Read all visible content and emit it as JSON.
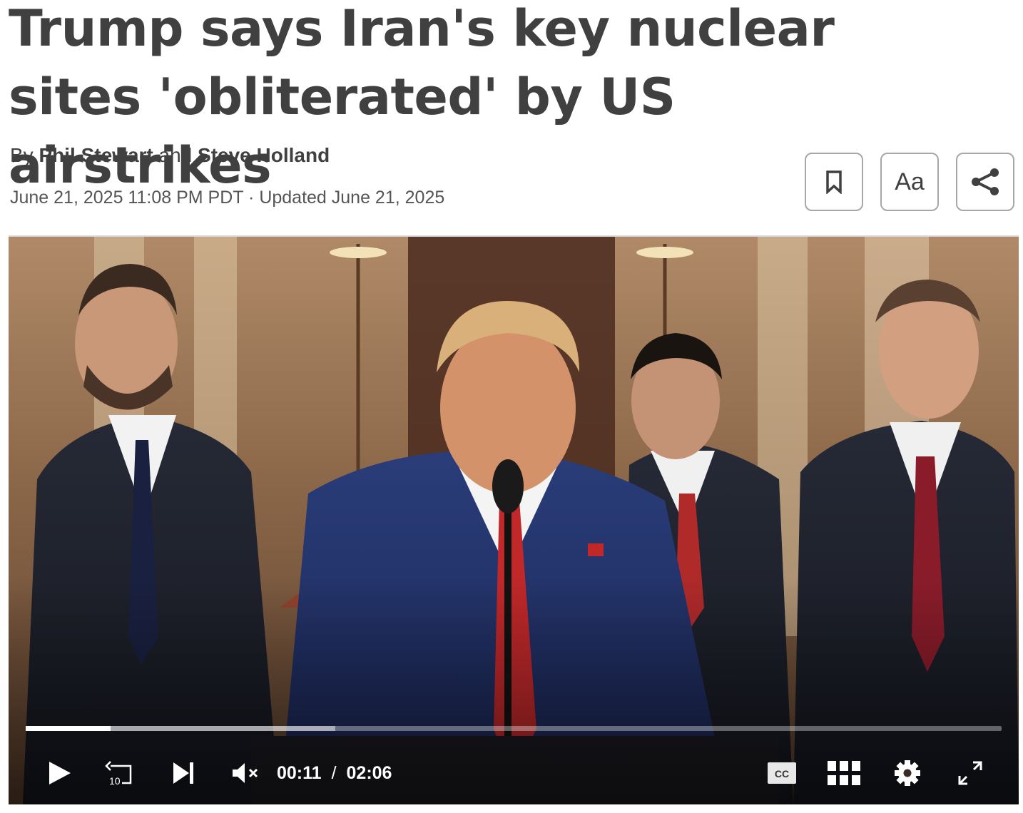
{
  "article": {
    "headline": "Trump says Iran's key nuclear sites 'obliterated' by US airstrikes",
    "byline_prefix": "By",
    "author_1": "Phil Stewart",
    "byline_and": "and",
    "author_2": "Steve Holland",
    "published": "June 21, 2025 11:08 PM PDT",
    "date_sep": "·",
    "updated": "Updated June 21, 2025"
  },
  "toolbar": {
    "bookmark_icon": "bookmark-icon",
    "text_size_label": "Aa",
    "share_icon": "share-icon"
  },
  "video": {
    "current_time": "00:11",
    "time_separator": "/",
    "duration": "02:06",
    "played_fraction": 0.087,
    "buffered_fraction": 0.317,
    "skip_seconds_label": "10",
    "cc_label": "CC",
    "icons": [
      "play-icon",
      "replay-10-icon",
      "next-icon",
      "mute-icon",
      "cc-icon",
      "grid-icon",
      "gear-icon",
      "fullscreen-icon"
    ]
  },
  "colors": {
    "text": "#404040",
    "button_border": "#a7a7a7",
    "video_controls": "#ffffff"
  }
}
